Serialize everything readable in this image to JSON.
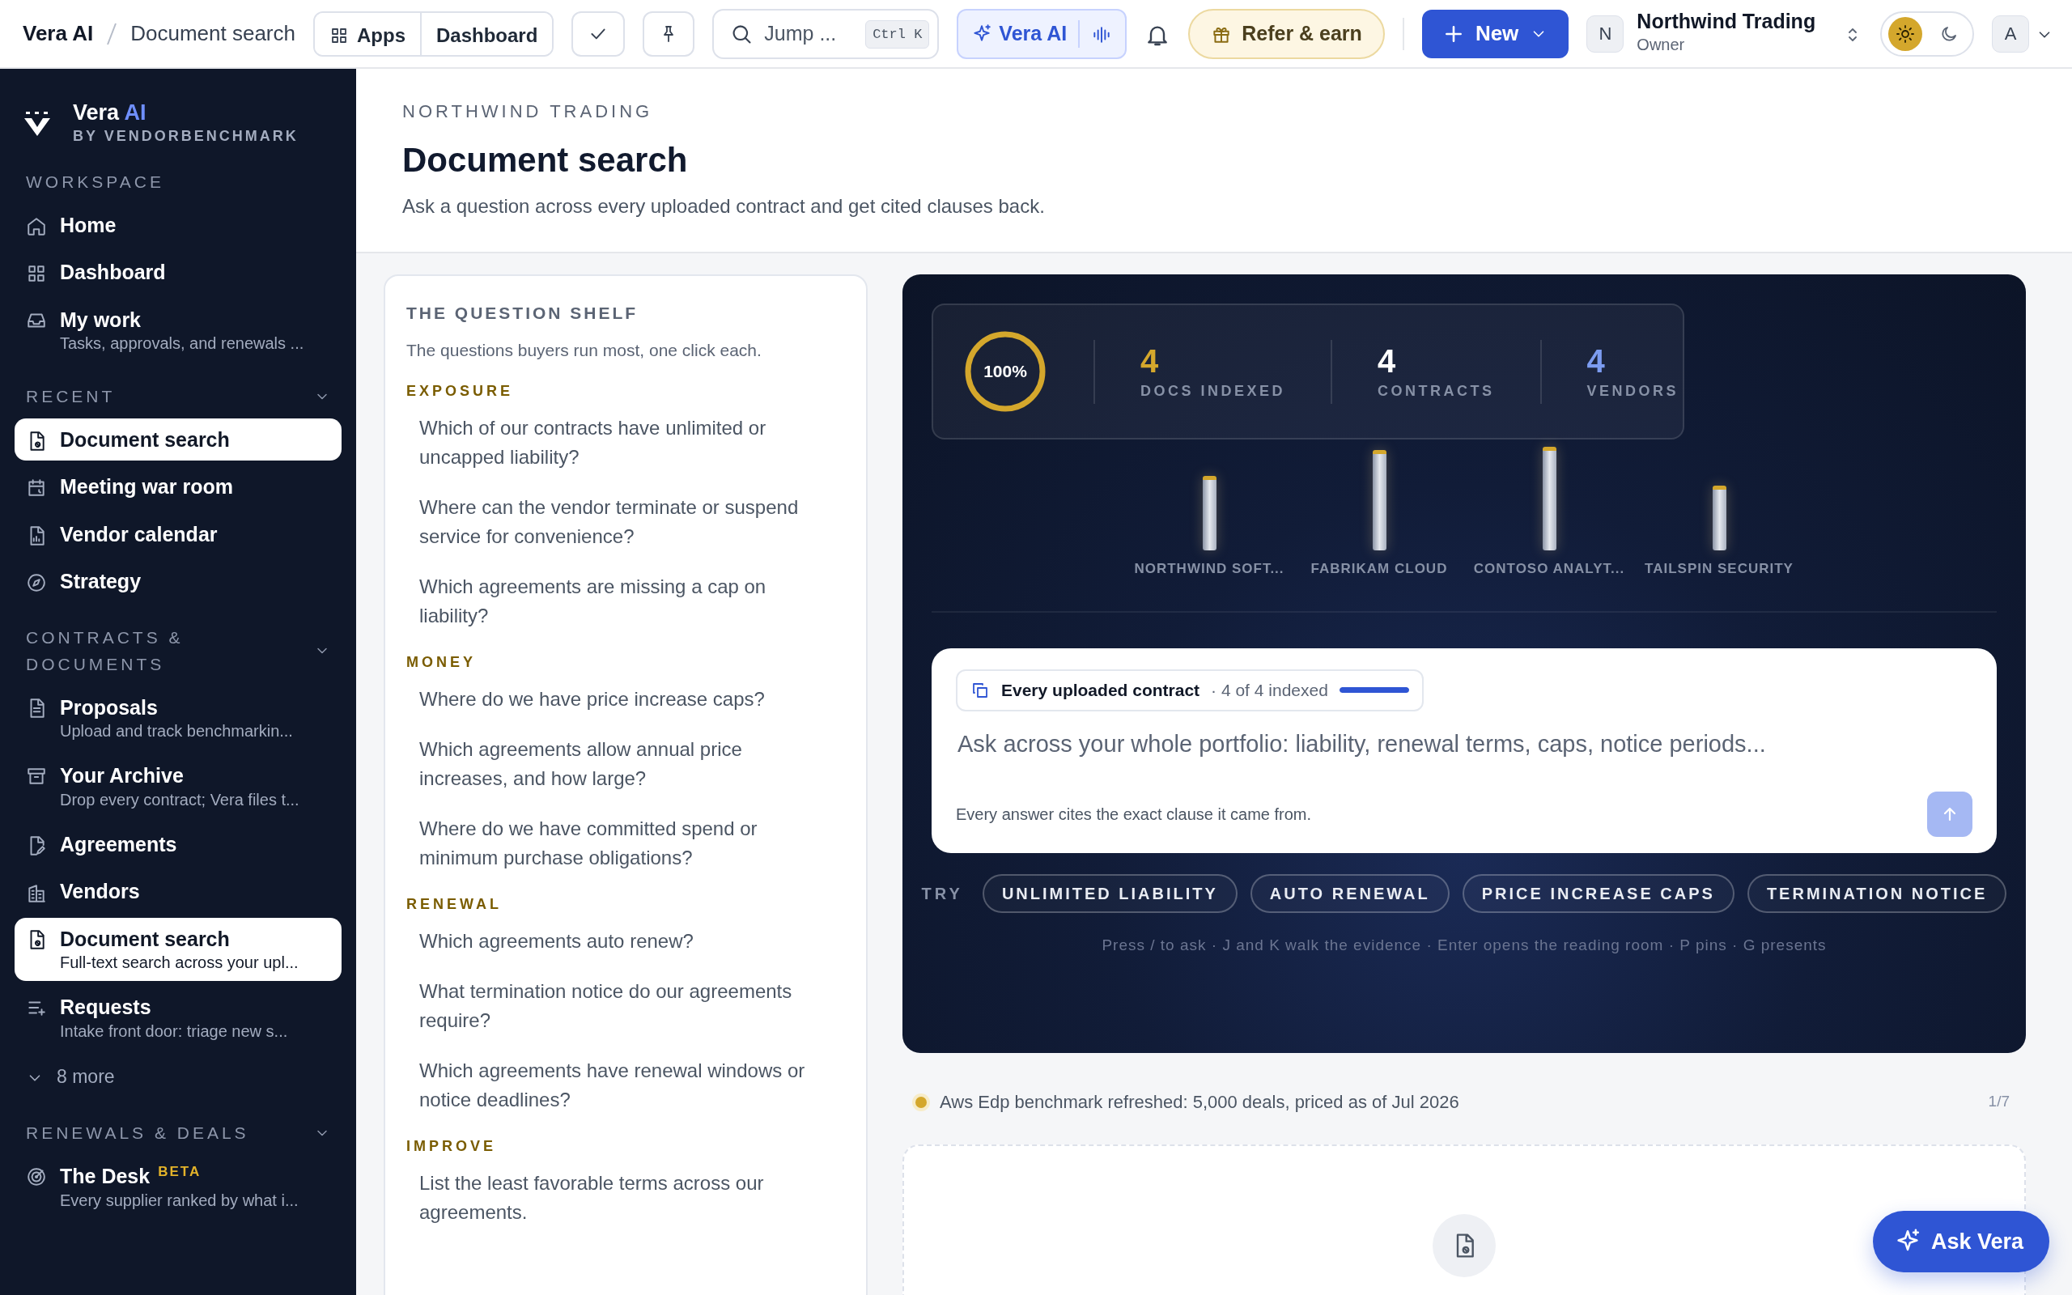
{
  "topbar": {
    "breadcrumb": [
      {
        "label": "Vera AI"
      },
      {
        "label": "Document search"
      }
    ],
    "app_buttons": [
      "Apps",
      "Dashboard"
    ],
    "search": {
      "placeholder": "Jump ...",
      "shortcut": "Ctrl K"
    },
    "assistant_button": "Vera AI",
    "refer_button": "Refer & earn",
    "new_button": "New",
    "org": {
      "initial": "N",
      "name": "Northwind Trading",
      "role": "Owner"
    },
    "theme": [
      {
        "kind": "light",
        "selected": true
      },
      {
        "kind": "dark",
        "selected": false
      }
    ],
    "user_initial": "A"
  },
  "sidebar": {
    "brand": {
      "name": "Vera",
      "accent": "AI",
      "tagline": "BY VENDORBENCHMARK"
    },
    "sections": [
      {
        "title": "WORKSPACE",
        "items": [
          {
            "label": "Home",
            "selected": false
          },
          {
            "label": "Dashboard",
            "selected": false
          },
          {
            "label": "My work",
            "subtitle": "Tasks, approvals, and renewals ...",
            "selected": false
          }
        ]
      },
      {
        "title": "RECENT",
        "expanded": true,
        "items": [
          {
            "label": "Document search",
            "selected": true
          },
          {
            "label": "Meeting war room",
            "selected": false
          },
          {
            "label": "Vendor calendar",
            "selected": false
          },
          {
            "label": "Strategy",
            "selected": false
          }
        ]
      },
      {
        "title": "CONTRACTS & DOCUMENTS",
        "expanded": true,
        "items": [
          {
            "label": "Proposals",
            "subtitle": "Upload and track benchmarkin...",
            "selected": false
          },
          {
            "label": "Your Archive",
            "subtitle": "Drop every contract; Vera files t...",
            "selected": false
          },
          {
            "label": "Agreements",
            "selected": false
          },
          {
            "label": "Vendors",
            "selected": false
          },
          {
            "label": "Document search",
            "subtitle": "Full-text search across your upl...",
            "selected": true
          },
          {
            "label": "Requests",
            "subtitle": "Intake front door: triage new s...",
            "selected": false
          },
          {
            "kind": "more",
            "label": "8 more",
            "selected": false
          }
        ]
      },
      {
        "title": "RENEWALS & DEALS",
        "expanded": true,
        "items": [
          {
            "label": "The Desk",
            "badge": "BETA",
            "subtitle": "Every supplier ranked by what i...",
            "selected": false
          }
        ]
      }
    ]
  },
  "header": {
    "eyebrow": "NORTHWIND TRADING",
    "title": "Document search",
    "subtitle": "Ask a question across every uploaded contract and get cited clauses back."
  },
  "shelf": {
    "title": "THE QUESTION SHELF",
    "subtitle": "The questions buyers run most, one click each.",
    "groups": [
      {
        "title": "EXPOSURE",
        "questions": [
          "Which of our contracts have unlimited or uncapped liability?",
          "Where can the vendor terminate or suspend service for convenience?",
          "Which agreements are missing a cap on liability?"
        ]
      },
      {
        "title": "MONEY",
        "questions": [
          "Where do we have price increase caps?",
          "Which agreements allow annual price increases, and how large?",
          "Where do we have committed spend or minimum purchase obligations?"
        ]
      },
      {
        "title": "RENEWAL",
        "questions": [
          "Which agreements auto renew?",
          "What termination notice do our agreements require?",
          "Which agreements have renewal windows or notice deadlines?"
        ]
      },
      {
        "title": "IMPROVE",
        "questions": [
          "List the least favorable terms across our agreements."
        ]
      }
    ]
  },
  "panel": {
    "ring": {
      "label": "100%"
    },
    "stats": [
      {
        "value": "4",
        "label": "DOCS INDEXED",
        "color": "#d4a72c"
      },
      {
        "value": "4",
        "label": "CONTRACTS",
        "color": "#ffffff"
      },
      {
        "value": "4",
        "label": "VENDORS",
        "color": "#7c9cf0"
      }
    ],
    "vendors": [
      {
        "label": "NORTHWIND SOFT..."
      },
      {
        "label": "FABRIKAM CLOUD"
      },
      {
        "label": "CONTOSO ANALYT..."
      },
      {
        "label": "TAILSPIN SECURITY"
      }
    ],
    "composer": {
      "scope": "Every uploaded contract",
      "count": "· 4 of 4 indexed",
      "level": 1,
      "placeholder": "Ask across your whole portfolio: liability, renewal terms, caps, notice periods...",
      "footnote": "Every answer cites the exact clause it came from.",
      "send_disabled": true
    },
    "try_label": "TRY",
    "chips": [
      "UNLIMITED LIABILITY",
      "AUTO RENEWAL",
      "PRICE INCREASE CAPS",
      "TERMINATION NOTICE"
    ],
    "shortcuts": "Press / to ask · J and K walk the evidence · Enter opens the reading room · P pins · G presents"
  },
  "status": {
    "text": "Aws Edp benchmark refreshed: 5,000 deals, priced as of Jul 2026",
    "pager": "1/7"
  },
  "ask_button": "Ask Vera"
}
